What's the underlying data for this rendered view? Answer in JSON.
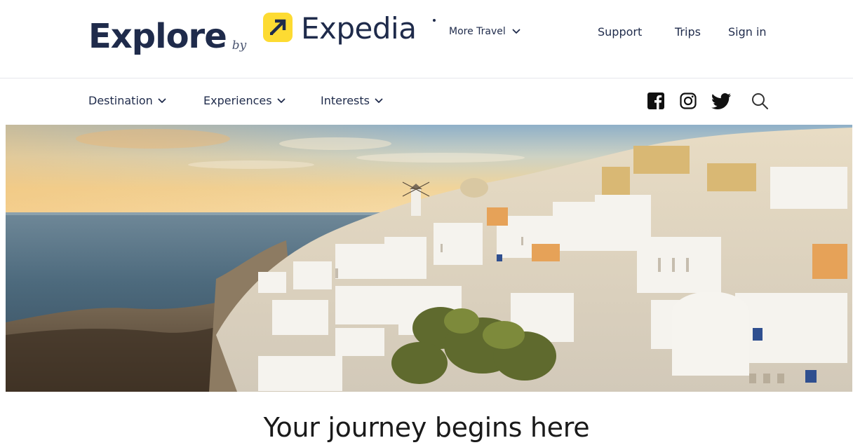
{
  "header": {
    "brand_explore": "Explore",
    "brand_by": "by",
    "brand_expedia": "Expedia",
    "more_travel": "More Travel",
    "support": "Support",
    "trips": "Trips",
    "sign_in": "Sign in"
  },
  "subnav": {
    "items": [
      {
        "label": "Destination",
        "icon": "chevron-down-icon"
      },
      {
        "label": "Experiences",
        "icon": "chevron-down-icon"
      },
      {
        "label": "Interests",
        "icon": "chevron-down-icon"
      }
    ],
    "social_icons": [
      "facebook-icon",
      "instagram-icon",
      "twitter-icon",
      "search-icon"
    ]
  },
  "hero": {
    "image": "santorini-oia-village-sunset"
  },
  "main": {
    "heading": "Your journey begins here"
  },
  "colors": {
    "navy": "#1f2b4b",
    "brand_yellow": "#fddb32",
    "divider": "#e6e7eb"
  }
}
